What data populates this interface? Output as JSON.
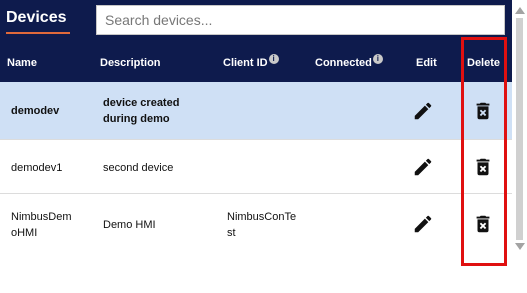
{
  "header": {
    "title": "Devices",
    "search_placeholder": "Search devices..."
  },
  "table": {
    "columns": {
      "name": "Name",
      "description": "Description",
      "client_id": "Client ID",
      "connected": "Connected",
      "edit": "Edit",
      "delete": "Delete"
    },
    "info_glyph": "i",
    "rows": [
      {
        "name": "demodev",
        "description": "device created during demo",
        "client_id": "",
        "connected": "",
        "selected": true
      },
      {
        "name": "demodev1",
        "description": "second device",
        "client_id": "",
        "connected": "",
        "selected": false
      },
      {
        "name": "NimbusDemoHMI",
        "description": "Demo HMI",
        "client_id": "NimbusConTest",
        "connected": "",
        "selected": false
      }
    ]
  },
  "icons": {
    "edit": "pencil-icon",
    "delete": "trash-icon",
    "info": "info-icon"
  },
  "colors": {
    "header_bg": "#0e1b4d",
    "title_underline": "#e06a3b",
    "selected_row_bg": "#cfe0f5",
    "highlight_border": "#e01010"
  }
}
